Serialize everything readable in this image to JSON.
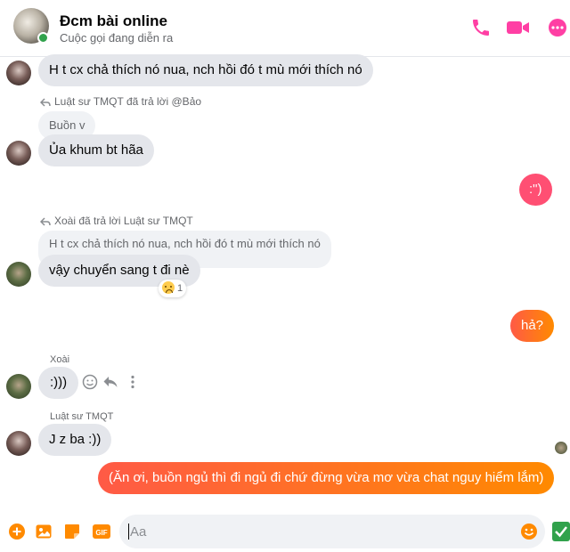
{
  "conversation": {
    "name": "Đcm bài online",
    "status": "Cuộc gọi đang diễn ra"
  },
  "messages": {
    "m1": "H t cx chả thích nó nua, nch hồi đó t mù mới thích nó",
    "m2_reply_note": "Luật sư TMQT đã trả lời @Bảo",
    "m2_quoted": "Buồn v",
    "m2": "Ủa khum bt hãa",
    "m3": ":\")",
    "m4_reply_note": "Xoài đã trả lời Luật sư TMQT",
    "m4_quoted": "H t cx chả thích nó nua, nch hồi đó t mù mới thích nó",
    "m4": "vậy chuyển sang t đi nè",
    "m4_reaction_count": "1",
    "m5": "hả?",
    "m6_sender": "Xoài",
    "m6": ":)))",
    "m7_sender": "Luật sư TMQT",
    "m7": "J z ba :))",
    "m8": "(Ăn ơi, buồn ngủ thì đi ngủ đi chứ đừng vừa mơ vừa chat nguy hiểm lắm)"
  },
  "composer": {
    "placeholder": "Aa"
  },
  "colors": {
    "accent": "#ff3fa4",
    "outgoing_gradient_start": "#ff5a46",
    "outgoing_gradient_end": "#ff8a00",
    "incoming_bubble": "#e4e6eb",
    "online": "#31a24c"
  },
  "icons": {
    "header": [
      "phone-icon",
      "video-camera-icon",
      "more-options-icon"
    ],
    "composer": [
      "plus-icon",
      "image-icon",
      "sticker-icon",
      "gif-icon",
      "emoji-icon",
      "send-icon"
    ],
    "message_actions": [
      "emoji-react-icon",
      "reply-icon",
      "more-vertical-icon"
    ]
  }
}
